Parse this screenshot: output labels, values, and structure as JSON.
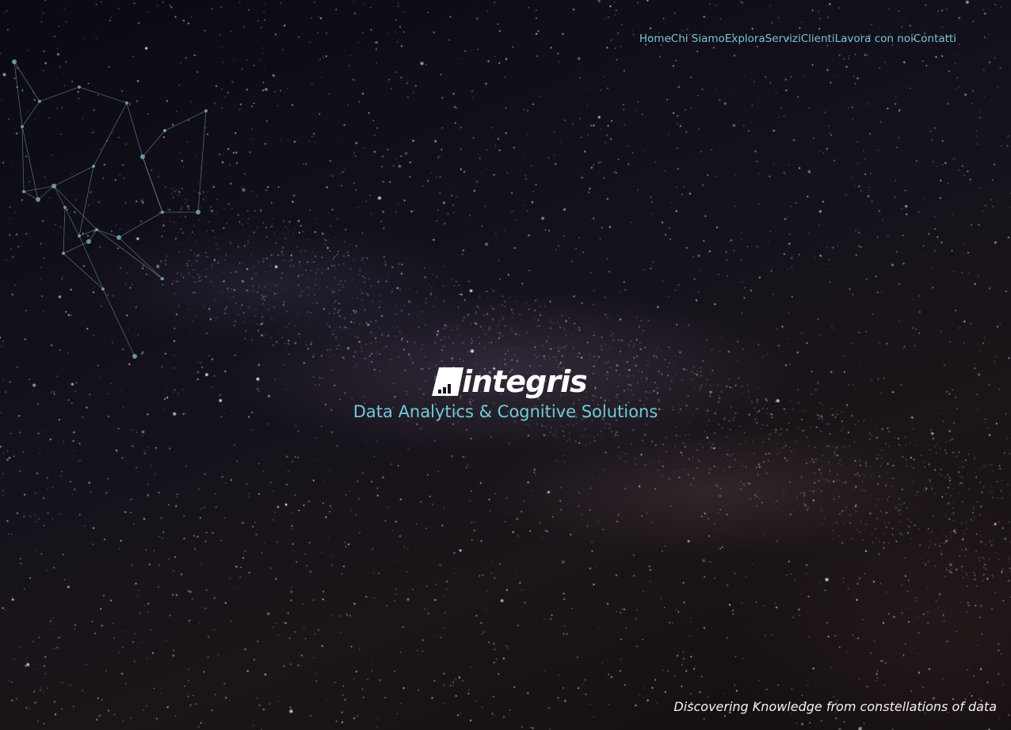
{
  "nav": {
    "items": [
      {
        "label": "Home"
      },
      {
        "label": "Chi Siamo"
      },
      {
        "label": "Explora"
      },
      {
        "label": "Servizi"
      },
      {
        "label": "Clienti"
      },
      {
        "label": "Lavora con noi"
      },
      {
        "label": "Contatti"
      }
    ]
  },
  "hero": {
    "logo_text": "integris",
    "tagline": "Data Analytics & Cognitive Solutions"
  },
  "footer": {
    "quote": "Discovering Knowledge from constellations of data"
  },
  "colors": {
    "nav_link": "#78c6d3",
    "tagline": "#6fcbd9",
    "logo": "#ffffff",
    "network_lines": "#7fb2c4"
  },
  "icons": {
    "logo_mark": "bar-chart-logo-icon",
    "background_network": "constellation-network-icon"
  }
}
